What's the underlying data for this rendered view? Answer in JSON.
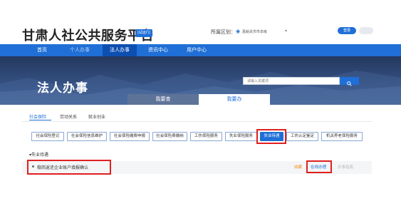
{
  "header": {
    "site_title": "甘肃人社公共服务平台",
    "trial_badge": "(试运行)",
    "region_label": "所属区划：",
    "region_value": "嘉峪关市市本级",
    "login_label": "登录"
  },
  "nav": {
    "items": [
      "首页",
      "个人办事",
      "法人办事",
      "资讯中心",
      "用户中心"
    ],
    "active_index": 2
  },
  "banner": {
    "title": "法人办事",
    "search_placeholder": "请输入关键词",
    "tabs": [
      "我要查",
      "我要办"
    ],
    "active_tab": 1
  },
  "subtabs": {
    "items": [
      "社会保险",
      "劳动关系",
      "就业创业"
    ],
    "active_index": 0
  },
  "categories": {
    "items": [
      "社会保险登记",
      "社会保险信息维护",
      "社会保险缴费申报",
      "社会保险费缴纳",
      "工伤保险服务",
      "失业保险服务",
      "失业待遇",
      "工伤认定鉴定",
      "机关养老保险服务"
    ],
    "selected_index": 6
  },
  "section": {
    "title": "▾失业待遇",
    "items": [
      {
        "name": "稳岗返还企业账户填报确认",
        "fav_label": "收藏",
        "apply_label": "在线办理",
        "guide_label": "办事指南"
      }
    ]
  },
  "colors": {
    "brand_blue": "#1f6fd6",
    "highlight_red": "#e02020",
    "favorite_orange": "#f08c1a"
  }
}
